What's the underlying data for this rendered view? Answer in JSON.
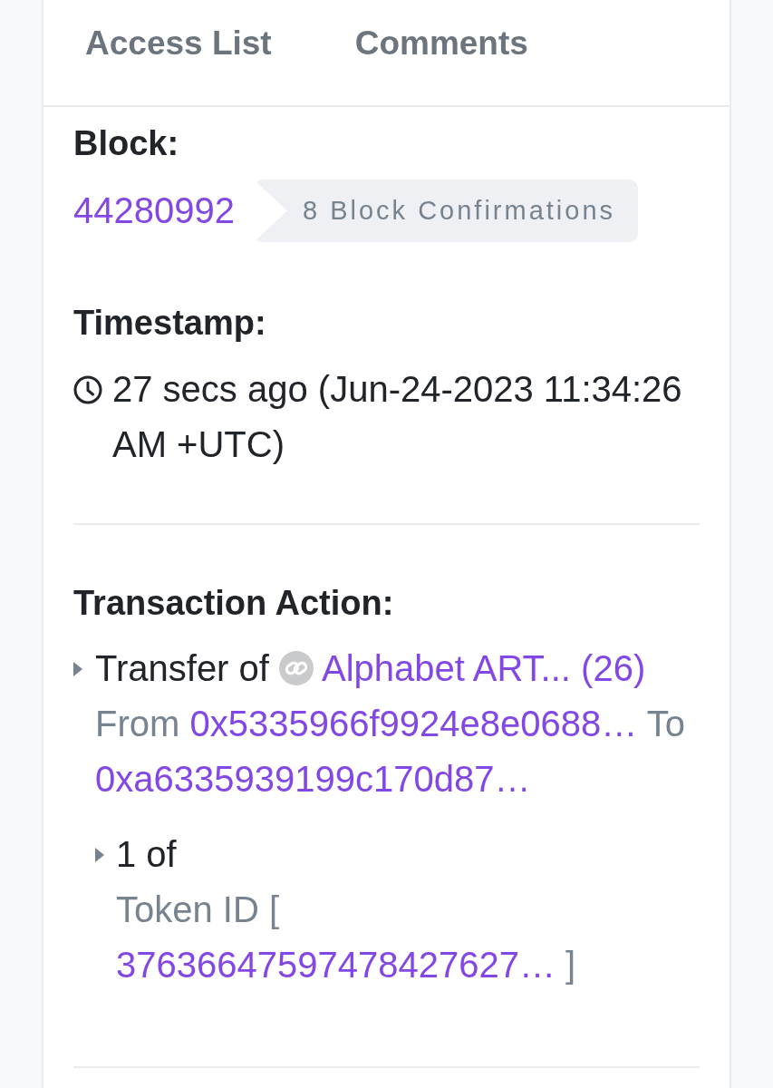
{
  "tabs": [
    {
      "label": "Access List",
      "selected": false
    },
    {
      "label": "Comments",
      "selected": false
    }
  ],
  "block": {
    "label": "Block:",
    "number": "44280992",
    "confirmations": "8 Block Confirmations"
  },
  "timestamp": {
    "label": "Timestamp:",
    "value": "27 secs ago (Jun-24-2023 11:34:26 AM +UTC)"
  },
  "transaction_action": {
    "label": "Transaction Action:",
    "items": [
      {
        "text": "Transfer of",
        "token": "Alphabet ART... (26)",
        "from_label": "From",
        "from": "0x5335966f9924e8e0688…",
        "to_label": "To",
        "to": "0xa6335939199c170d87…",
        "children": [
          {
            "amount": "1 of",
            "token_id_label": "Token ID [",
            "token_id": "37636647597478427627…",
            "token_id_end": "]"
          }
        ]
      }
    ]
  }
}
